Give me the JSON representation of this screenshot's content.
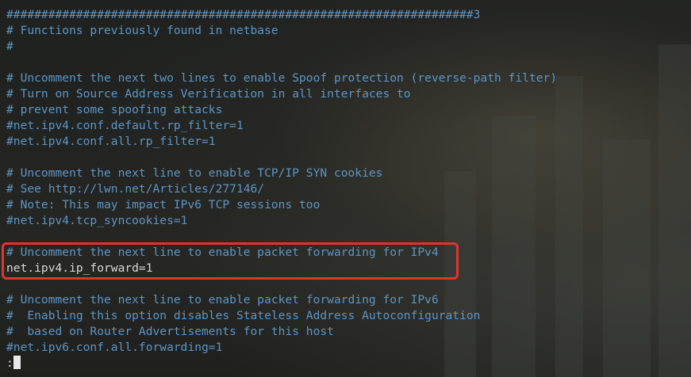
{
  "lines": [
    {
      "t": "c",
      "text": "###################################################################3"
    },
    {
      "t": "c",
      "text": "# Functions previously found in netbase"
    },
    {
      "t": "c",
      "text": "#"
    },
    {
      "t": "blank",
      "text": ""
    },
    {
      "t": "c",
      "text": "# Uncomment the next two lines to enable Spoof protection (reverse-path filter)"
    },
    {
      "t": "c",
      "text": "# Turn on Source Address Verification in all interfaces to"
    },
    {
      "t": "c",
      "text": "# prevent some spoofing attacks"
    },
    {
      "t": "c",
      "text": "#net.ipv4.conf.default.rp_filter=1"
    },
    {
      "t": "c",
      "text": "#net.ipv4.conf.all.rp_filter=1"
    },
    {
      "t": "blank",
      "text": ""
    },
    {
      "t": "c",
      "text": "# Uncomment the next line to enable TCP/IP SYN cookies"
    },
    {
      "t": "c",
      "text": "# See http://lwn.net/Articles/277146/"
    },
    {
      "t": "c",
      "text": "# Note: This may impact IPv6 TCP sessions too"
    },
    {
      "t": "c",
      "text": "#net.ipv4.tcp_syncookies=1"
    },
    {
      "t": "blank",
      "text": ""
    },
    {
      "t": "c",
      "text": "# Uncomment the next line to enable packet forwarding for IPv4"
    },
    {
      "t": "p",
      "text": "net.ipv4.ip_forward=1"
    },
    {
      "t": "blank",
      "text": ""
    },
    {
      "t": "c",
      "text": "# Uncomment the next line to enable packet forwarding for IPv6"
    },
    {
      "t": "c",
      "text": "#  Enabling this option disables Stateless Address Autoconfiguration"
    },
    {
      "t": "c",
      "text": "#  based on Router Advertisements for this host"
    },
    {
      "t": "c",
      "text": "#net.ipv6.conf.all.forwarding=1"
    }
  ],
  "prompt": ":",
  "colors": {
    "comment": "#5d95c4",
    "text": "#d8d8d8",
    "highlight": "#e0362a"
  }
}
